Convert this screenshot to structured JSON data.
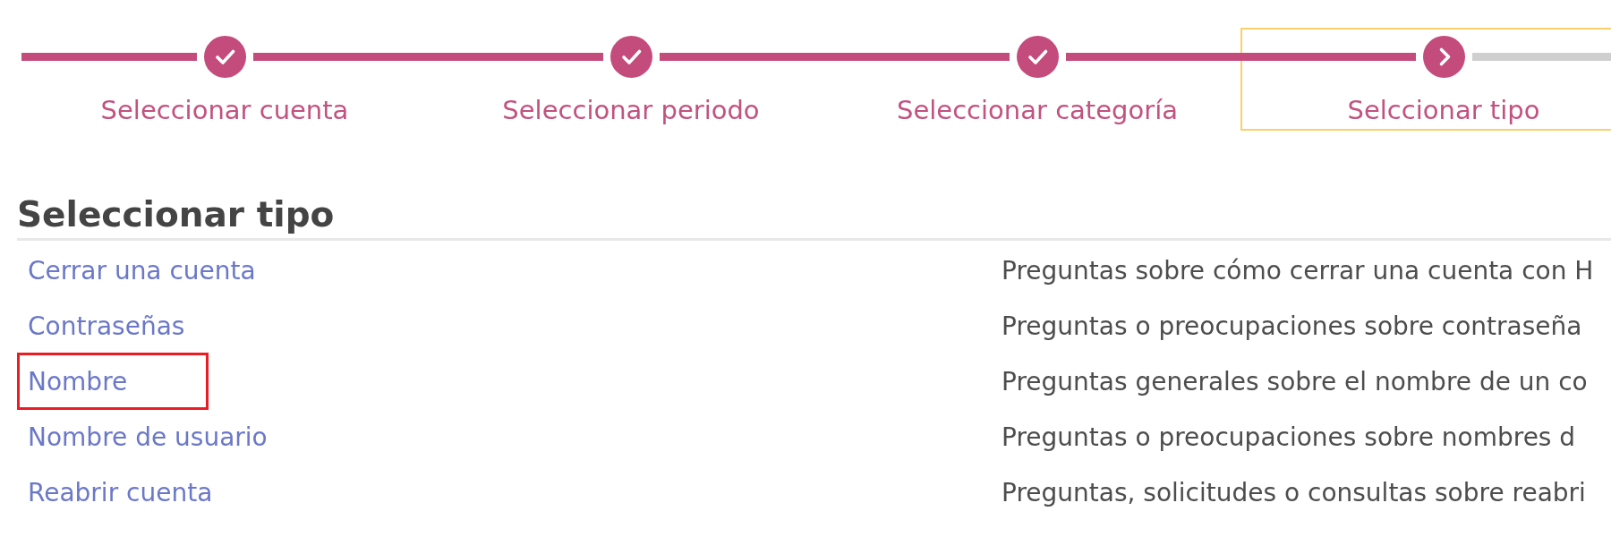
{
  "stepper": {
    "steps": [
      {
        "label": "Seleccionar cuenta",
        "completed": true,
        "selected": false
      },
      {
        "label": "Seleccionar periodo",
        "completed": true,
        "selected": false
      },
      {
        "label": "Seleccionar categoría",
        "completed": true,
        "selected": false
      },
      {
        "label": "Selccionar tipo",
        "completed": false,
        "selected": true
      }
    ]
  },
  "section": {
    "title": "Seleccionar tipo",
    "types": [
      {
        "name": "Cerrar una cuenta",
        "description": "Preguntas sobre cómo cerrar una cuenta con H",
        "highlighted": false
      },
      {
        "name": "Contraseñas",
        "description": "Preguntas o preocupaciones sobre contraseña",
        "highlighted": false
      },
      {
        "name": "Nombre",
        "description": "Preguntas generales sobre el nombre de un co",
        "highlighted": true
      },
      {
        "name": "Nombre de usuario",
        "description": "Preguntas o preocupaciones sobre nombres d",
        "highlighted": false
      },
      {
        "name": "Reabrir cuenta",
        "description": "Preguntas, solicitudes o consultas sobre reabri",
        "highlighted": false
      }
    ]
  }
}
